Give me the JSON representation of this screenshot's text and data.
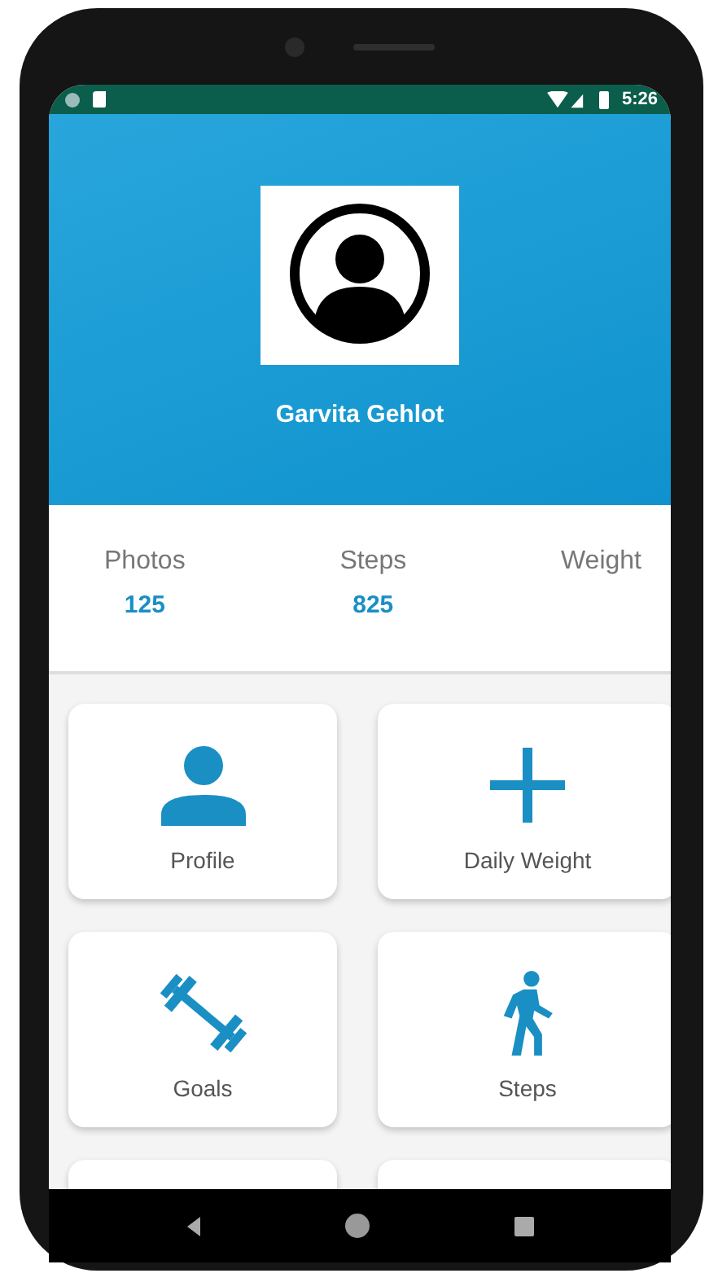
{
  "status_bar": {
    "time": "5:26"
  },
  "profile": {
    "name": "Garvita Gehlot"
  },
  "stats": [
    {
      "label": "Photos",
      "value": "125"
    },
    {
      "label": "Steps",
      "value": "825"
    },
    {
      "label": "Weight"
    }
  ],
  "tiles": [
    {
      "kind": "person",
      "label": "Profile"
    },
    {
      "kind": "plus",
      "label": "Daily Weight"
    },
    {
      "kind": "dumbbell",
      "label": "Goals"
    },
    {
      "kind": "walk",
      "label": "Steps"
    },
    {
      "kind": "blank"
    },
    {
      "kind": "blank"
    }
  ]
}
